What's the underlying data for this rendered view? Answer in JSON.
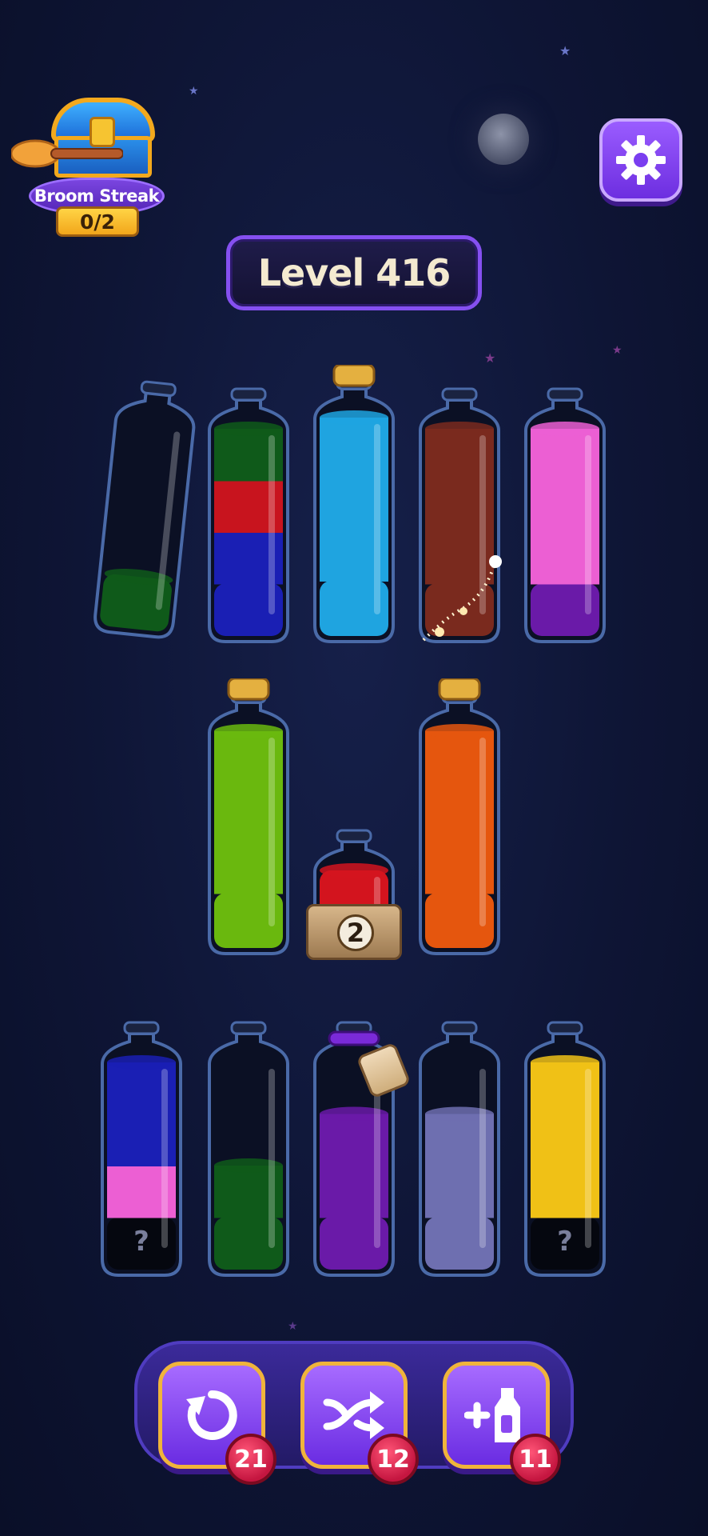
{
  "streak": {
    "title": "Broom Streak",
    "count": "0/2",
    "icon": "treasure-chest-icon"
  },
  "level": {
    "label": "Level 416"
  },
  "settings": {
    "icon": "gear-icon"
  },
  "bottles": [
    {
      "id": "top-1",
      "layers": [
        "#0f5a1a"
      ],
      "capped": false
    },
    {
      "id": "top-2",
      "layers": [
        "#1a1fb4",
        "#1a1fb4",
        "#c8141e",
        "#0f5a1a"
      ],
      "capped": false
    },
    {
      "id": "top-3",
      "layers": [
        "#1fa4e0",
        "#1fa4e0",
        "#1fa4e0",
        "#1fa4e0"
      ],
      "capped": true
    },
    {
      "id": "top-4",
      "layers": [
        "#7a2a1e",
        "#7a2a1e",
        "#7a2a1e",
        "#7a2a1e"
      ],
      "capped": false
    },
    {
      "id": "top-5",
      "layers": [
        "#6a1aa8",
        "#ec5fd3",
        "#ec5fd3",
        "#ec5fd3"
      ],
      "capped": false
    },
    {
      "id": "mid-1",
      "layers": [
        "#6ab80e",
        "#6ab80e",
        "#6ab80e",
        "#6ab80e"
      ],
      "capped": true
    },
    {
      "id": "mid-2",
      "layers": [
        "#d3141e"
      ],
      "capped": false,
      "locked_count": "2"
    },
    {
      "id": "mid-3",
      "layers": [
        "#e5560e",
        "#e5560e",
        "#e5560e",
        "#e5560e"
      ],
      "capped": true
    },
    {
      "id": "bot-1",
      "layers": [
        "hidden",
        "#ec5fd3",
        "#1a1fb4",
        "#1a1fb4"
      ],
      "capped": false,
      "hidden_label": "?"
    },
    {
      "id": "bot-2",
      "layers": [
        "#0f5a1a",
        "#0f5a1a"
      ],
      "capped": false
    },
    {
      "id": "bot-3",
      "layers": [
        "#6a1aa8",
        "#6a1aa8",
        "#6a1aa8"
      ],
      "capped": false,
      "tied": true
    },
    {
      "id": "bot-4",
      "layers": [
        "#6e6fb0",
        "#6e6fb0",
        "#6e6fb0"
      ],
      "capped": false
    },
    {
      "id": "bot-5",
      "layers": [
        "hidden",
        "#f0c116",
        "#f0c116",
        "#f0c116"
      ],
      "capped": false,
      "hidden_label": "?"
    }
  ],
  "tools": [
    {
      "name": "undo",
      "icon": "undo-icon",
      "count": "21"
    },
    {
      "name": "shuffle",
      "icon": "shuffle-icon",
      "count": "12"
    },
    {
      "name": "add-bottle",
      "icon": "add-bottle-icon",
      "count": "11"
    }
  ],
  "colors": {
    "accent": "#8550f0",
    "badge": "#c51640",
    "gold": "#f0b43b"
  }
}
